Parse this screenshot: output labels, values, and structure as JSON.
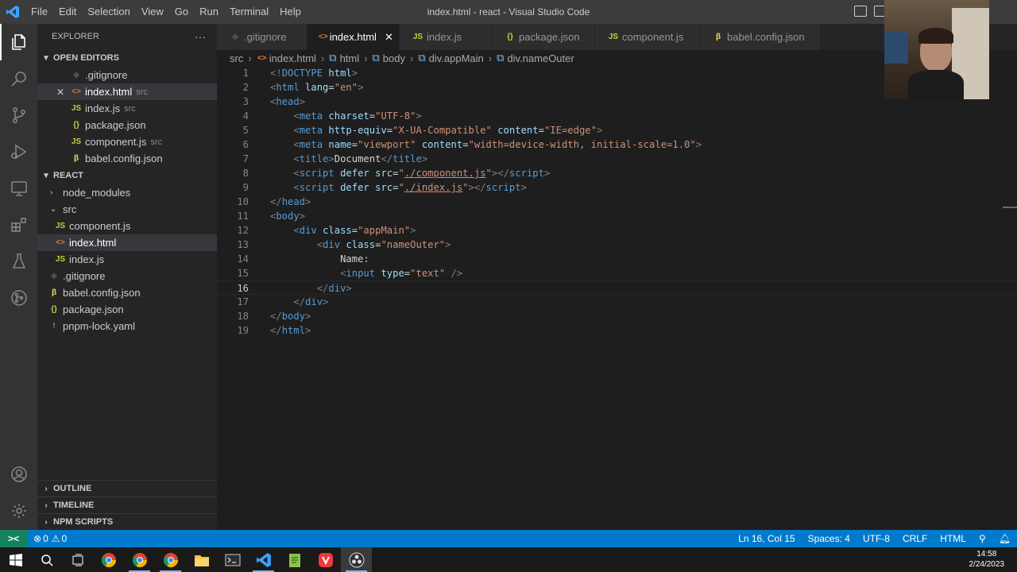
{
  "window": {
    "title": "index.html - react - Visual Studio Code"
  },
  "menu": [
    "File",
    "Edit",
    "Selection",
    "View",
    "Go",
    "Run",
    "Terminal",
    "Help"
  ],
  "sidebar": {
    "title": "EXPLORER",
    "more": "···",
    "open_editors_label": "OPEN EDITORS",
    "open_editors": [
      {
        "icon": "git",
        "glyph": "◆",
        "name": ".gitignore",
        "desc": ""
      },
      {
        "icon": "html",
        "glyph": "<>",
        "name": "index.html",
        "desc": "src"
      },
      {
        "icon": "js",
        "glyph": "JS",
        "name": "index.js",
        "desc": "src"
      },
      {
        "icon": "json",
        "glyph": "{}",
        "name": "package.json",
        "desc": ""
      },
      {
        "icon": "js",
        "glyph": "JS",
        "name": "component.js",
        "desc": "src"
      },
      {
        "icon": "babel",
        "glyph": "β",
        "name": "babel.config.json",
        "desc": ""
      }
    ],
    "project_label": "REACT",
    "tree": {
      "node_modules": "node_modules",
      "src": "src",
      "component_js": "component.js",
      "index_html": "index.html",
      "index_js": "index.js",
      "gitignore": ".gitignore",
      "babel": "babel.config.json",
      "package": "package.json",
      "pnpm": "pnpm-lock.yaml"
    },
    "outline": "OUTLINE",
    "timeline": "TIMELINE",
    "npm": "NPM SCRIPTS"
  },
  "tabs": [
    {
      "glyph": "◆",
      "label": ".gitignore"
    },
    {
      "glyph": "<>",
      "label": "index.html"
    },
    {
      "glyph": "JS",
      "label": "index.js"
    },
    {
      "glyph": "{}",
      "label": "package.json"
    },
    {
      "glyph": "JS",
      "label": "component.js"
    },
    {
      "glyph": "β",
      "label": "babel.config.json"
    }
  ],
  "tab_close": "✕",
  "breadcrumb": [
    "src",
    "index.html",
    "html",
    "body",
    "div.appMain",
    "div.nameOuter"
  ],
  "editor": {
    "lines": [
      {
        "n": "1"
      },
      {
        "n": "2"
      },
      {
        "n": "3"
      },
      {
        "n": "4"
      },
      {
        "n": "5"
      },
      {
        "n": "6"
      },
      {
        "n": "7"
      },
      {
        "n": "8"
      },
      {
        "n": "9"
      },
      {
        "n": "10"
      },
      {
        "n": "11"
      },
      {
        "n": "12"
      },
      {
        "n": "13"
      },
      {
        "n": "14"
      },
      {
        "n": "15"
      },
      {
        "n": "16"
      },
      {
        "n": "17"
      },
      {
        "n": "18"
      },
      {
        "n": "19"
      }
    ],
    "tokens": {
      "doctype": "DOCTYPE",
      "html": "html",
      "lang": "lang",
      "en": "\"en\"",
      "head": "head",
      "meta": "meta",
      "charset": "charset",
      "utf8": "\"UTF-8\"",
      "httpequiv": "http-equiv",
      "xua": "\"X-UA-Compatible\"",
      "content": "content",
      "ieedge": "\"IE=edge\"",
      "name": "name",
      "viewport": "\"viewport\"",
      "vpcontent": "\"width=device-width, initial-scale=1.0\"",
      "title": "title",
      "document": "Document",
      "script": "script",
      "defer": "defer",
      "src": "src",
      "comp": "./component.js",
      "idx": "./index.js",
      "quote": "\"",
      "body": "body",
      "div": "div",
      "class": "class",
      "appmain": "\"appMain\"",
      "nameouter": "\"nameOuter\"",
      "namelabel": "Name:",
      "input": "input",
      "type": "type",
      "text": "\"text\""
    }
  },
  "status": {
    "remote": "><",
    "errors": "0",
    "warnings": "0",
    "position": "Ln 16, Col 15",
    "spaces": "Spaces: 4",
    "encoding": "UTF-8",
    "eol": "CRLF",
    "language": "HTML"
  },
  "clock": {
    "time": "14:58",
    "date": "2/24/2023"
  }
}
